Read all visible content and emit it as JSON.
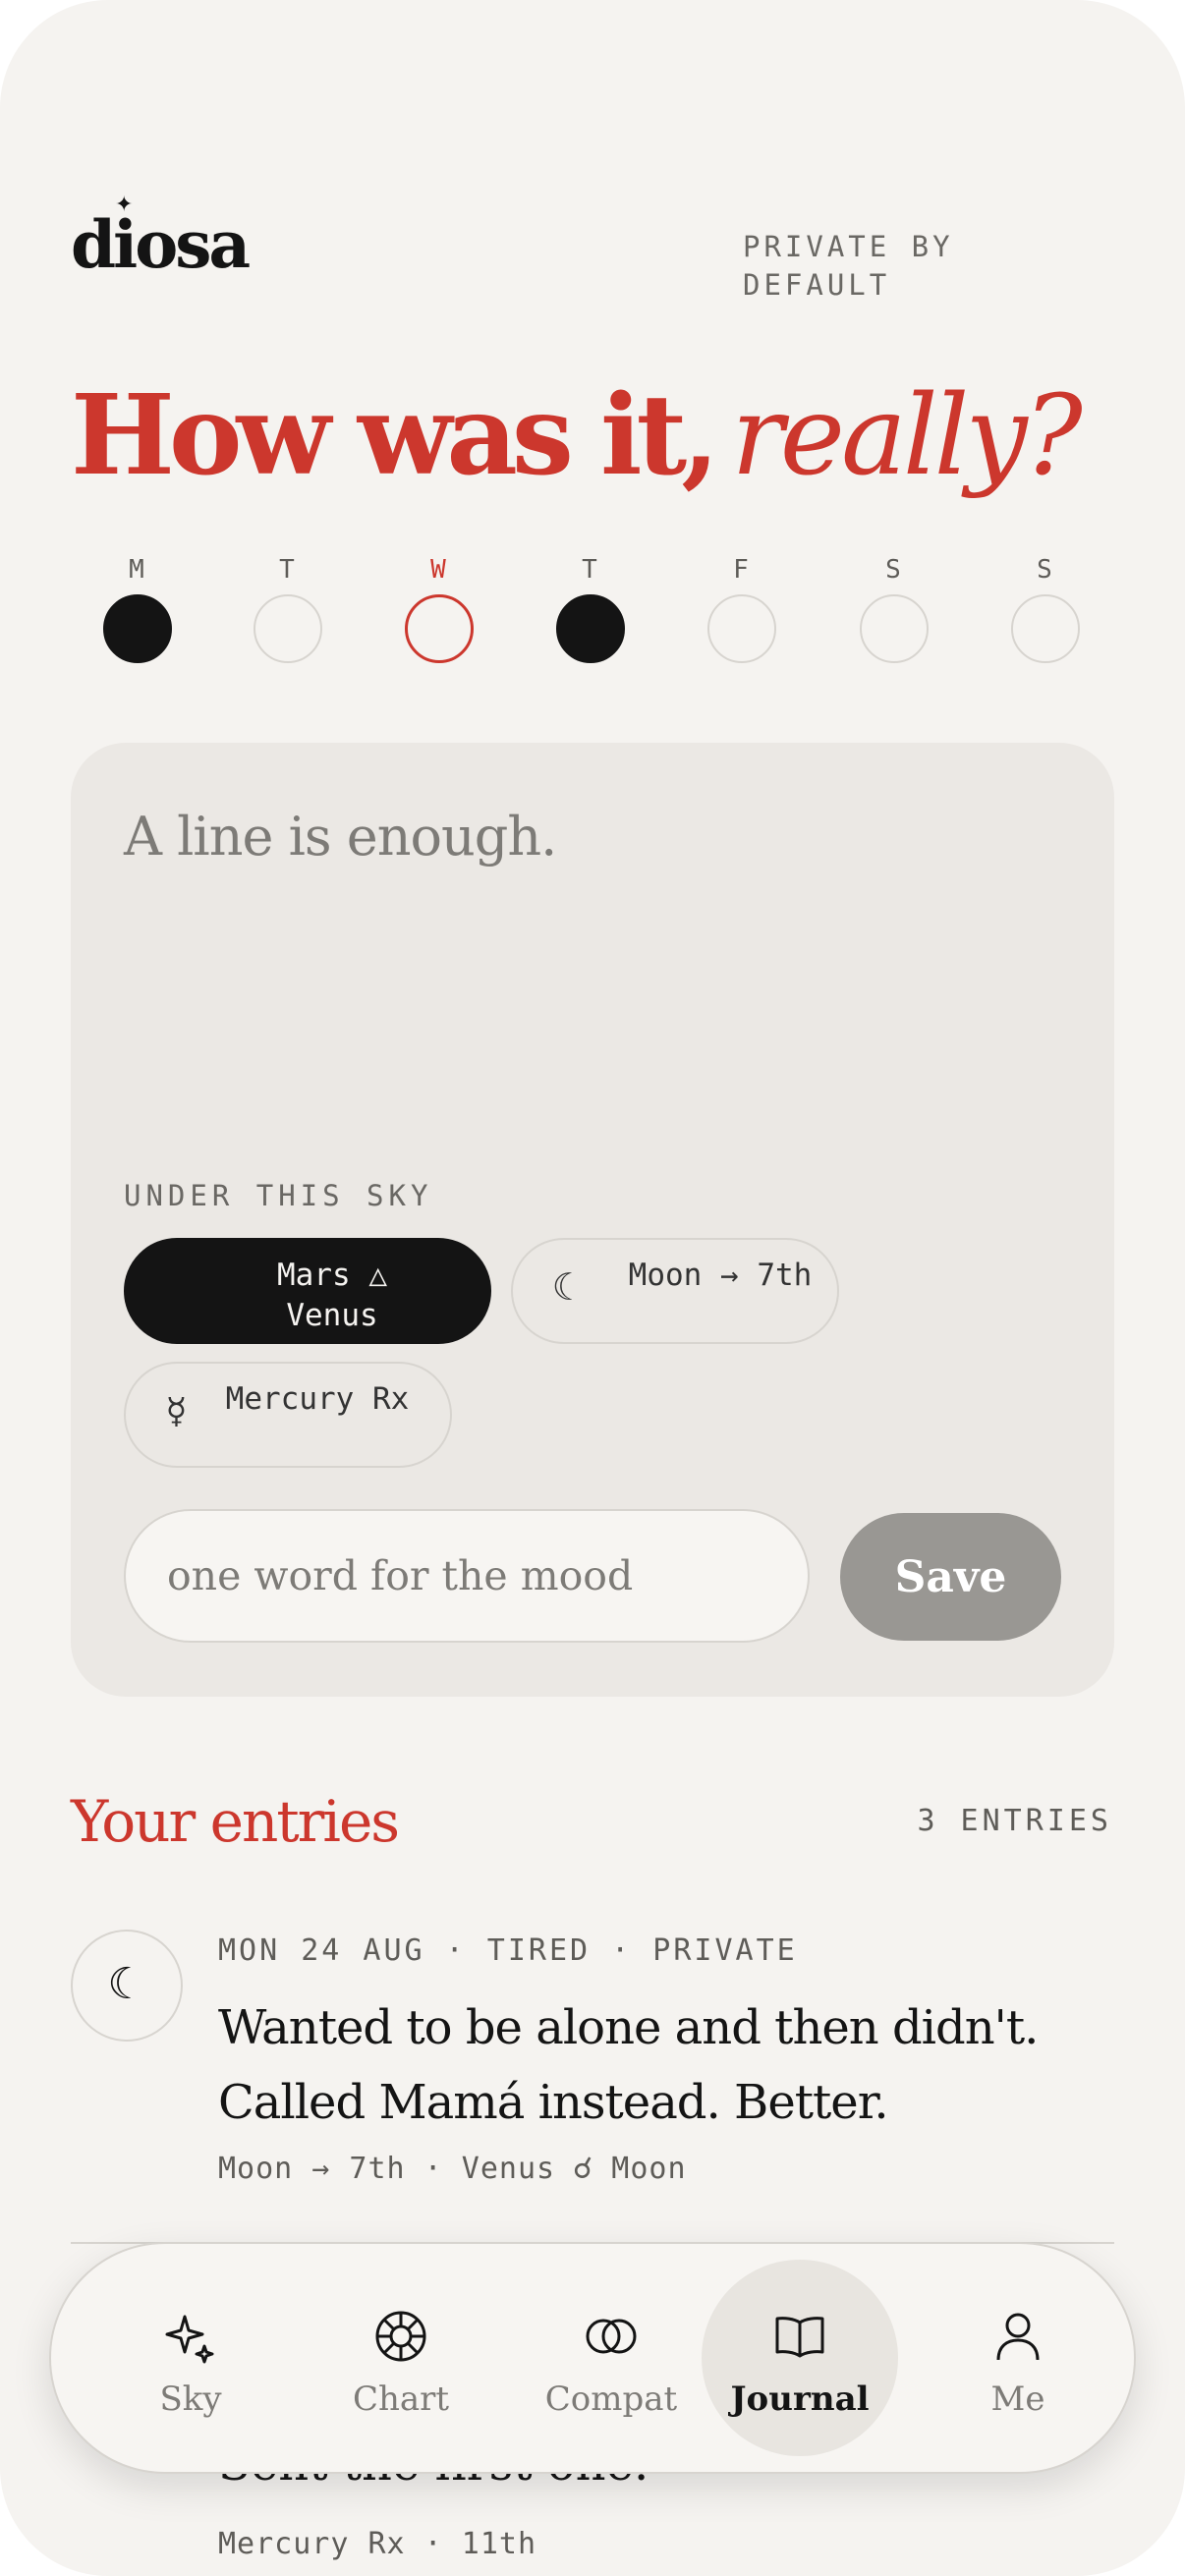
{
  "header": {
    "logo": "diosa",
    "privacy_note": "PRIVATE BY DEFAULT",
    "headline_main": "How was it,",
    "headline_italic": "really?"
  },
  "week": [
    {
      "label": "M",
      "state": "filled"
    },
    {
      "label": "T",
      "state": "empty"
    },
    {
      "label": "W",
      "state": "today"
    },
    {
      "label": "T",
      "state": "filled"
    },
    {
      "label": "F",
      "state": "empty"
    },
    {
      "label": "S",
      "state": "empty"
    },
    {
      "label": "S",
      "state": "empty"
    }
  ],
  "composer": {
    "prompt": "A line is enough.",
    "sky_label": "UNDER THIS SKY",
    "chips": [
      {
        "label": "Mars △ Venus",
        "icon": "",
        "active": true
      },
      {
        "label": "Moon → 7th",
        "icon": "☾",
        "active": false
      },
      {
        "label": "Mercury Rx",
        "icon": "☿",
        "active": false
      }
    ],
    "mood_placeholder": "one word for the mood",
    "mood_value": "",
    "save_label": "Save"
  },
  "entries": {
    "title": "Your entries",
    "count": "3 ENTRIES",
    "items": [
      {
        "icon": "☾",
        "meta": "MON 24 AUG · TIRED · PRIVATE",
        "body": "Wanted to be alone and then didn't. Called Mamá instead. Better.",
        "tags": "Moon → 7th · Venus ☌ Moon"
      },
      {
        "body_fragment": "Sent the first one.",
        "tags": "Mercury Rx · 11th"
      }
    ]
  },
  "tabbar": {
    "tabs": [
      {
        "label": "Sky",
        "icon": "sparkle-icon",
        "active": false
      },
      {
        "label": "Chart",
        "icon": "chart-wheel-icon",
        "active": false
      },
      {
        "label": "Compat",
        "icon": "rings-icon",
        "active": false
      },
      {
        "label": "Journal",
        "icon": "book-icon",
        "active": true
      },
      {
        "label": "Me",
        "icon": "person-icon",
        "active": false
      }
    ]
  },
  "colors": {
    "accent": "#cc372d",
    "background": "#f5f3f0",
    "card": "#ebe8e4",
    "ink": "#141414"
  }
}
